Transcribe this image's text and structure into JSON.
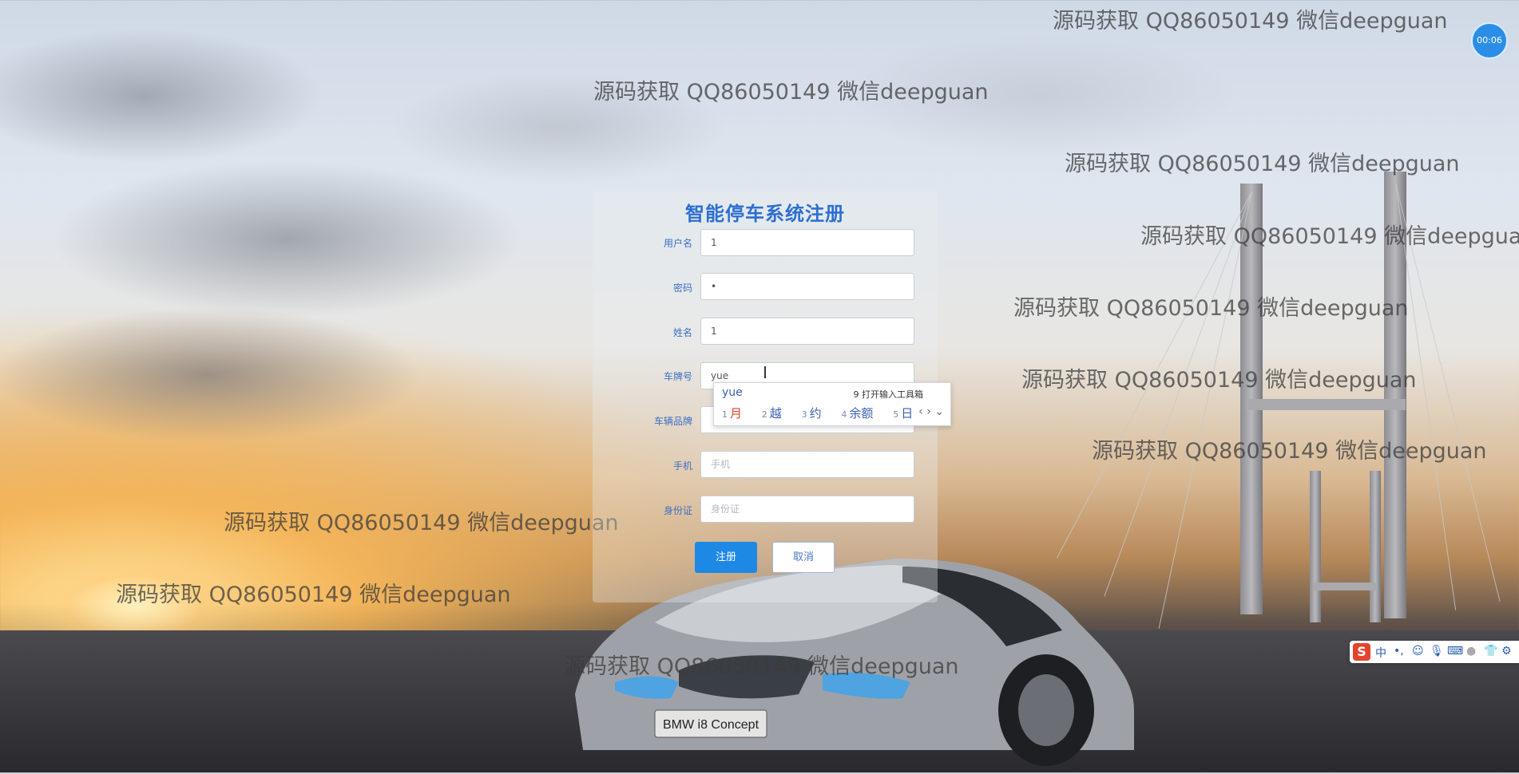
{
  "page": {
    "title": "智能停车系统注册",
    "timer": "00:06",
    "watermark_text": "源码获取 QQ86050149 微信deepguan"
  },
  "form": {
    "fields": [
      {
        "label": "用户名",
        "value": "1",
        "placeholder": ""
      },
      {
        "label": "密码",
        "value": "•",
        "placeholder": ""
      },
      {
        "label": "姓名",
        "value": "1",
        "placeholder": ""
      },
      {
        "label": "车牌号",
        "value": "yue",
        "placeholder": ""
      },
      {
        "label": "车辆品牌",
        "value": "",
        "placeholder": ""
      },
      {
        "label": "手机",
        "value": "",
        "placeholder": "手机"
      },
      {
        "label": "身份证",
        "value": "",
        "placeholder": "身份证"
      }
    ],
    "buttons": {
      "register": "注册",
      "cancel": "取消"
    }
  },
  "ime_popup": {
    "pinyin": "yue",
    "toolbox": "9 打开输入工具箱",
    "candidates": [
      {
        "num": "1",
        "text": "月"
      },
      {
        "num": "2",
        "text": "越"
      },
      {
        "num": "3",
        "text": "约"
      },
      {
        "num": "4",
        "text": "余额"
      },
      {
        "num": "5",
        "text": "日"
      }
    ],
    "nav": "‹ › ⌄"
  },
  "ime_toolbar": {
    "logo": "S",
    "lang": "中",
    "icons": [
      "punctuation-icon",
      "emoji-icon",
      "mic-icon",
      "keyboard-icon",
      "user-icon",
      "skin-icon",
      "settings-icon"
    ]
  },
  "car": {
    "plate": "BMW i8 Concept"
  }
}
